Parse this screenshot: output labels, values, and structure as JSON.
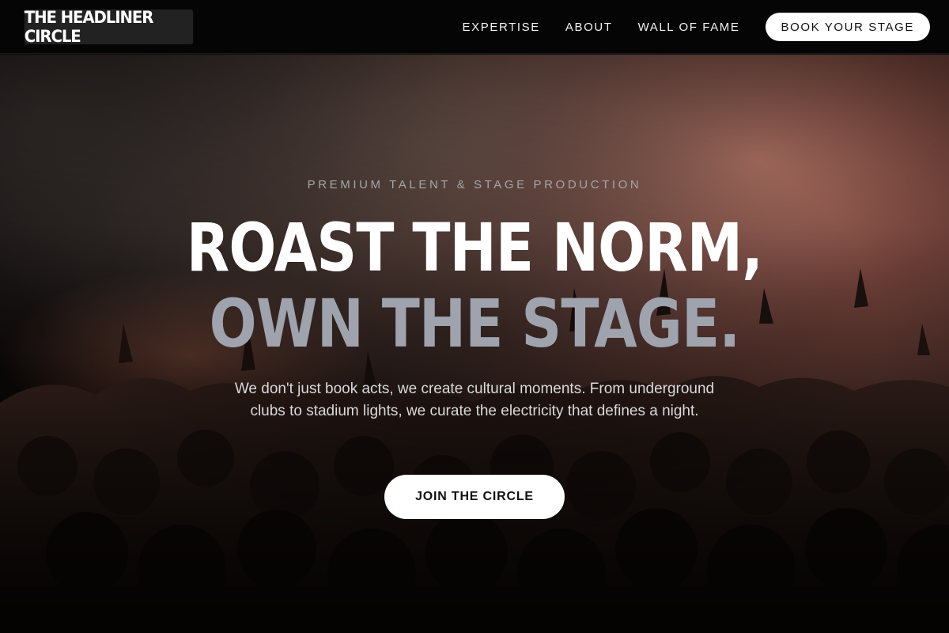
{
  "header": {
    "logo": "THE HEADLINER CIRCLE",
    "nav": [
      {
        "label": "EXPERTISE"
      },
      {
        "label": "ABOUT"
      },
      {
        "label": "WALL OF FAME"
      }
    ],
    "cta_label": "BOOK YOUR STAGE"
  },
  "hero": {
    "eyebrow": "PREMIUM TALENT & STAGE PRODUCTION",
    "headline_line1": "ROAST THE NORM,",
    "headline_line2": "OWN THE STAGE.",
    "subtext": "We don't just book acts, we create cultural moments. From underground clubs to stadium lights, we curate the electricity that defines a night.",
    "cta_label": "JOIN THE CIRCLE",
    "background": "concert-crowd-photo"
  },
  "colors": {
    "header_bg": "#050505",
    "logo_bg": "#222222",
    "headline_primary": "#ffffff",
    "headline_secondary": "#9ea3ae",
    "button_bg": "#ffffff",
    "button_text": "#111111"
  }
}
